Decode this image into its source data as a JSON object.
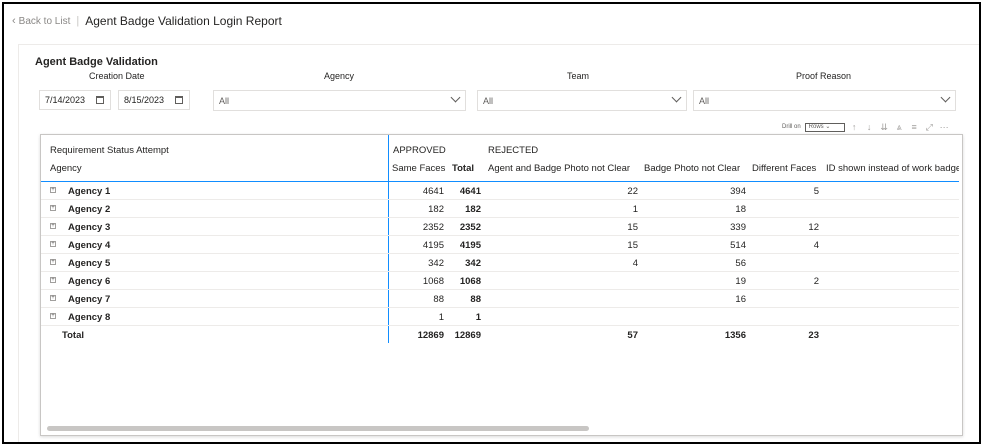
{
  "header": {
    "back_label": "Back to List",
    "separator": "|",
    "title": "Agent Badge Validation Login Report"
  },
  "page_heading": "Agent Badge Validation",
  "slicers": {
    "creation_date": {
      "title": "Creation Date",
      "start": "7/14/2023",
      "end": "8/15/2023"
    },
    "agency": {
      "title": "Agency",
      "value": "All"
    },
    "team": {
      "title": "Team",
      "value": "All"
    },
    "proof_reason": {
      "title": "Proof Reason",
      "value": "All"
    }
  },
  "visual_toolbar": {
    "drill_label": "Drill on",
    "drill_value": "Rows",
    "icons": [
      "arrow-up-icon",
      "arrow-down-icon",
      "double-arrow-down-icon",
      "expand-hierarchy-icon",
      "filter-icon",
      "focus-mode-icon",
      "more-options-icon"
    ]
  },
  "matrix": {
    "row_header_top": "Requirement Status Attempt",
    "row_header": "Agency",
    "groups": [
      "APPROVED",
      "REJECTED"
    ],
    "columns": [
      "Same Faces",
      "Total",
      "Agent and Badge Photo not Clear",
      "Badge Photo not Clear",
      "Different Faces",
      "ID shown instead of work badge"
    ],
    "rows": [
      {
        "agency": "Agency 1",
        "same_faces": "4641",
        "total": "4641",
        "agent_badge_not_clear": "22",
        "badge_not_clear": "394",
        "different_faces": "5"
      },
      {
        "agency": "Agency 2",
        "same_faces": "182",
        "total": "182",
        "agent_badge_not_clear": "1",
        "badge_not_clear": "18",
        "different_faces": ""
      },
      {
        "agency": "Agency 3",
        "same_faces": "2352",
        "total": "2352",
        "agent_badge_not_clear": "15",
        "badge_not_clear": "339",
        "different_faces": "12"
      },
      {
        "agency": "Agency 4",
        "same_faces": "4195",
        "total": "4195",
        "agent_badge_not_clear": "15",
        "badge_not_clear": "514",
        "different_faces": "4"
      },
      {
        "agency": "Agency 5",
        "same_faces": "342",
        "total": "342",
        "agent_badge_not_clear": "4",
        "badge_not_clear": "56",
        "different_faces": ""
      },
      {
        "agency": "Agency 6",
        "same_faces": "1068",
        "total": "1068",
        "agent_badge_not_clear": "",
        "badge_not_clear": "19",
        "different_faces": "2"
      },
      {
        "agency": "Agency 7",
        "same_faces": "88",
        "total": "88",
        "agent_badge_not_clear": "",
        "badge_not_clear": "16",
        "different_faces": ""
      },
      {
        "agency": "Agency 8",
        "same_faces": "1",
        "total": "1",
        "agent_badge_not_clear": "",
        "badge_not_clear": "",
        "different_faces": ""
      }
    ],
    "total_row": {
      "label": "Total",
      "same_faces": "12869",
      "total": "12869",
      "agent_badge_not_clear": "57",
      "badge_not_clear": "1356",
      "different_faces": "23"
    }
  },
  "colors": {
    "accent": "#118dff",
    "border": "#e1dfdd"
  }
}
